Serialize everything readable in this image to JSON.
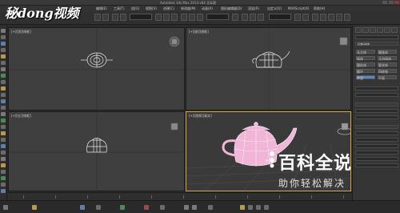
{
  "window": {
    "title": "Autodesk 3ds Max 2014 x64    无标题"
  },
  "menu": {
    "items": [
      "编辑(E)",
      "工具(T)",
      "组(G)",
      "视图(V)",
      "创建(C)",
      "修改器(M)",
      "动画(A)",
      "图形编辑器(D)",
      "渲染(R)",
      "自定义(U)",
      "MAXScript(X)",
      "帮助(H)"
    ]
  },
  "watermark_logo": {
    "text": "秘dong视频"
  },
  "viewports": {
    "top": {
      "label": "[+][顶][线框]"
    },
    "front": {
      "label": "[+][前][线框]"
    },
    "left": {
      "label": "[+][左][线框]"
    },
    "perspective": {
      "label": "[+][透视][真实]"
    }
  },
  "command_panel": {
    "section_label": "标准基本体",
    "buttons": [
      "长方体",
      "圆锥体",
      "球体",
      "几何球体",
      "圆柱体",
      "管状体",
      "圆环",
      "四棱锥",
      "茶壶",
      "平面"
    ]
  },
  "baike_watermark": {
    "title": "百科全说",
    "subtitle": "助你轻松解决"
  },
  "colors": {
    "viewport_bg": "#3f3f3f",
    "active_border": "#d6a43b",
    "teapot_wire": "#e8e8e8",
    "teapot_pink": "#f1b5d8",
    "selected_button": "#5b87c9"
  }
}
